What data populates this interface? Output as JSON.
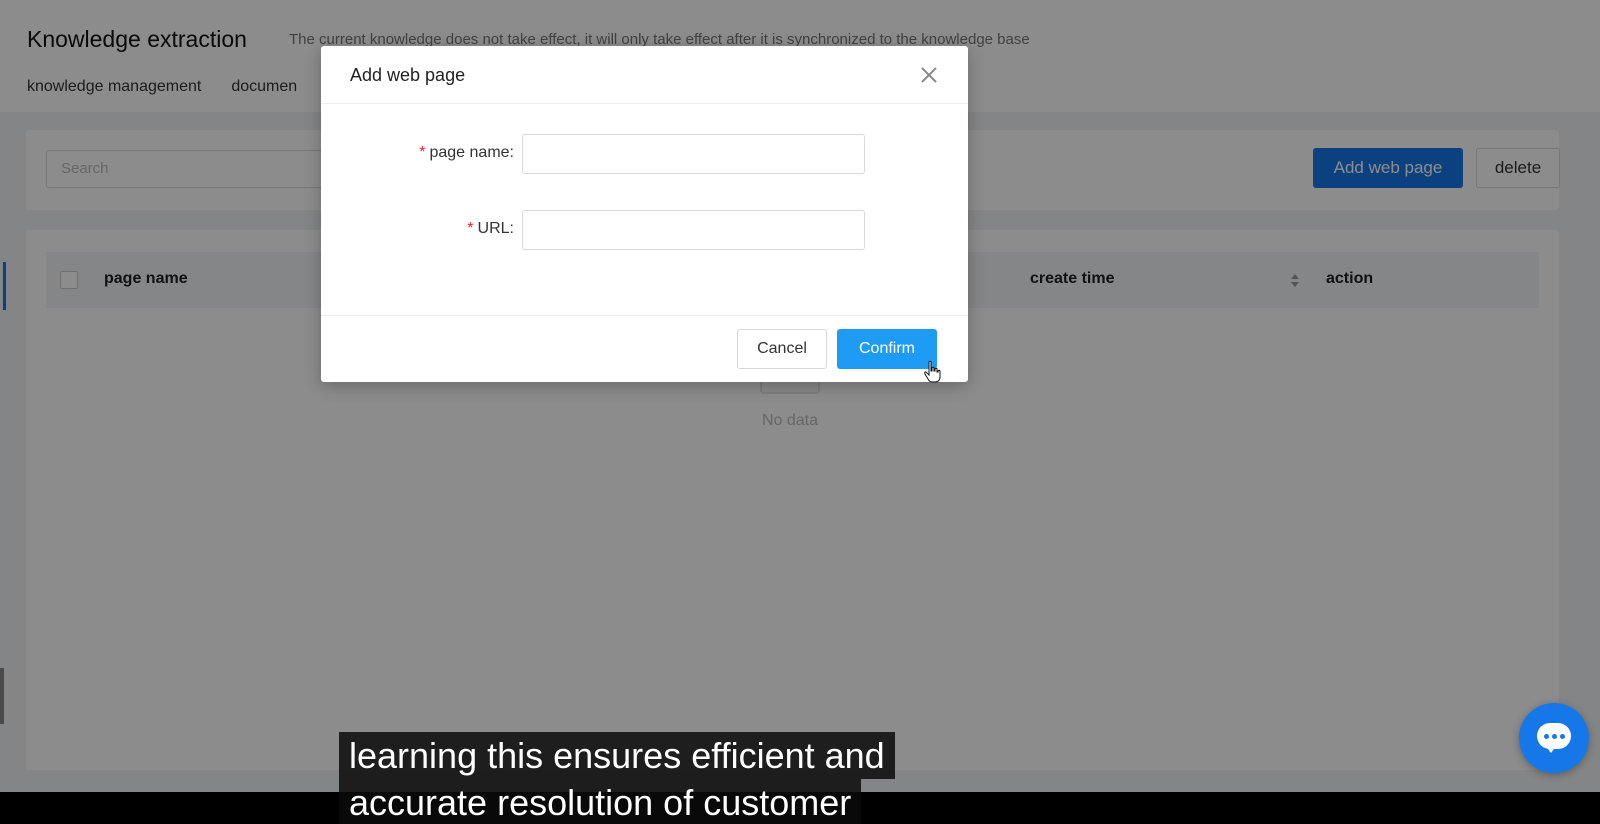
{
  "page": {
    "title": "Knowledge extraction",
    "subtitle": "The current knowledge does not take effect, it will only take effect after it is synchronized to the knowledge base",
    "tabs": [
      "knowledge management",
      "documen"
    ]
  },
  "toolbar": {
    "search_placeholder": "Search",
    "add_label": "Add web page",
    "delete_label": "delete"
  },
  "table": {
    "columns": {
      "page_name": "page name",
      "create_time": "create time",
      "action": "action"
    },
    "empty_text": "No data"
  },
  "modal": {
    "title": "Add web page",
    "fields": [
      {
        "label": "page name",
        "required_mark": "*",
        "value": ""
      },
      {
        "label": "URL",
        "required_mark": "*",
        "value": ""
      }
    ],
    "cancel_label": "Cancel",
    "confirm_label": "Confirm"
  },
  "captions": {
    "line1": "learning this ensures efficient and",
    "line2": "accurate resolution of customer"
  },
  "colors": {
    "primary": "#1677e8",
    "confirm": "#1e9cf5",
    "required": "#f5222d"
  }
}
